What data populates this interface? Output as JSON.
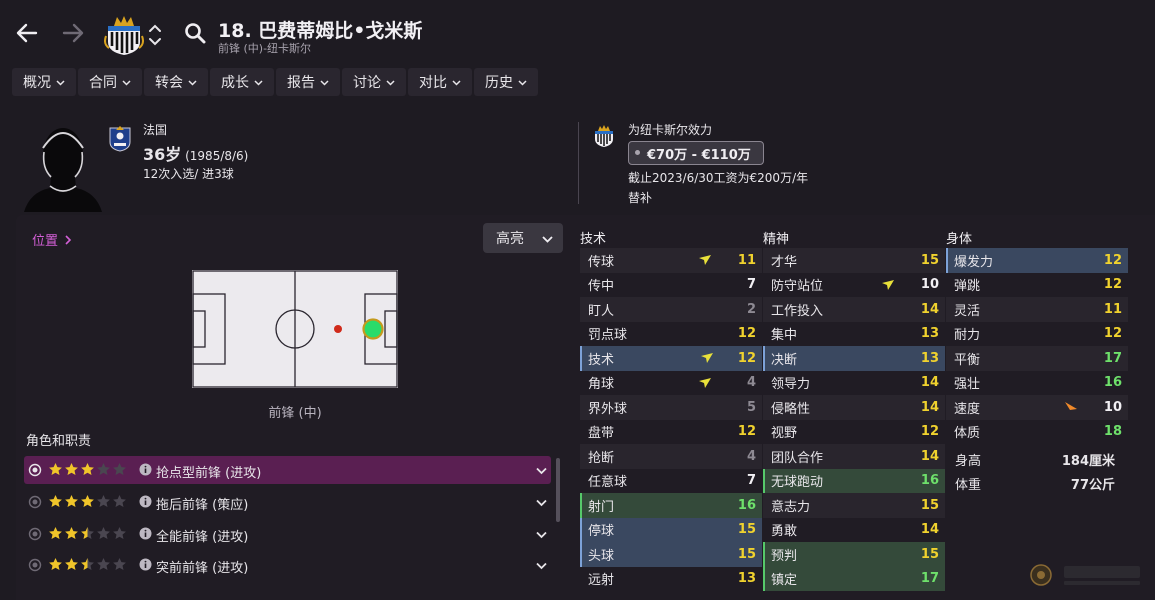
{
  "header": {
    "title": "18. 巴费蒂姆比•戈米斯",
    "subtitle": "前锋 (中)-纽卡斯尔"
  },
  "menu": [
    {
      "label": "概况"
    },
    {
      "label": "合同"
    },
    {
      "label": "转会"
    },
    {
      "label": "成长"
    },
    {
      "label": "报告"
    },
    {
      "label": "讨论"
    },
    {
      "label": "对比"
    },
    {
      "label": "历史"
    }
  ],
  "profile": {
    "nation": "法国",
    "age": "36岁",
    "birth": "(1985/8/6)",
    "caps": "12次入选/ 进3球",
    "plays_for": "为纽卡斯尔效力",
    "value": "€70万 - €110万",
    "contract": "截止2023/6/30工资为€200万/年",
    "status": "替补"
  },
  "position_panel": {
    "link_label": "位置",
    "highlight_label": "高亮",
    "pitch_label": "前锋 (中)",
    "roles_title": "角色和职责"
  },
  "roles": [
    {
      "name": "抢点型前锋 (进攻)",
      "stars": 3,
      "selected": true
    },
    {
      "name": "拖后前锋 (策应)",
      "stars": 3,
      "selected": false
    },
    {
      "name": "全能前锋 (进攻)",
      "stars": 2.5,
      "selected": false
    },
    {
      "name": "突前前锋 (进攻)",
      "stars": 2.5,
      "selected": false
    }
  ],
  "attributes": {
    "technical": {
      "title": "技术",
      "items": [
        {
          "name": "传球",
          "value": "11",
          "color": "yellow",
          "style": "alt",
          "arrow": "up"
        },
        {
          "name": "传中",
          "value": "7",
          "color": "white",
          "style": "",
          "arrow": ""
        },
        {
          "name": "盯人",
          "value": "2",
          "color": "gray",
          "style": "alt",
          "arrow": ""
        },
        {
          "name": "罚点球",
          "value": "12",
          "color": "yellow",
          "style": "",
          "arrow": ""
        },
        {
          "name": "技术",
          "value": "12",
          "color": "yellow",
          "style": "hl",
          "arrow": "up"
        },
        {
          "name": "角球",
          "value": "4",
          "color": "gray",
          "style": "",
          "arrow": "up"
        },
        {
          "name": "界外球",
          "value": "5",
          "color": "gray",
          "style": "alt",
          "arrow": ""
        },
        {
          "name": "盘带",
          "value": "12",
          "color": "yellow",
          "style": "",
          "arrow": ""
        },
        {
          "name": "抢断",
          "value": "4",
          "color": "gray",
          "style": "alt",
          "arrow": ""
        },
        {
          "name": "任意球",
          "value": "7",
          "color": "white",
          "style": "",
          "arrow": ""
        },
        {
          "name": "射门",
          "value": "16",
          "color": "green",
          "style": "green",
          "arrow": ""
        },
        {
          "name": "停球",
          "value": "15",
          "color": "yellow",
          "style": "hl",
          "arrow": ""
        },
        {
          "name": "头球",
          "value": "15",
          "color": "yellow",
          "style": "hl",
          "arrow": ""
        },
        {
          "name": "远射",
          "value": "13",
          "color": "yellow",
          "style": "",
          "arrow": ""
        }
      ]
    },
    "mental": {
      "title": "精神",
      "items": [
        {
          "name": "才华",
          "value": "15",
          "color": "yellow",
          "style": "alt",
          "arrow": ""
        },
        {
          "name": "防守站位",
          "value": "10",
          "color": "white",
          "style": "",
          "arrow": "up"
        },
        {
          "name": "工作投入",
          "value": "14",
          "color": "yellow",
          "style": "alt",
          "arrow": ""
        },
        {
          "name": "集中",
          "value": "13",
          "color": "yellow",
          "style": "",
          "arrow": ""
        },
        {
          "name": "决断",
          "value": "13",
          "color": "yellow",
          "style": "hl",
          "arrow": ""
        },
        {
          "name": "领导力",
          "value": "14",
          "color": "yellow",
          "style": "",
          "arrow": ""
        },
        {
          "name": "侵略性",
          "value": "14",
          "color": "yellow",
          "style": "alt",
          "arrow": ""
        },
        {
          "name": "视野",
          "value": "12",
          "color": "yellow",
          "style": "",
          "arrow": ""
        },
        {
          "name": "团队合作",
          "value": "14",
          "color": "yellow",
          "style": "alt",
          "arrow": ""
        },
        {
          "name": "无球跑动",
          "value": "16",
          "color": "green",
          "style": "green",
          "arrow": ""
        },
        {
          "name": "意志力",
          "value": "15",
          "color": "yellow",
          "style": "alt",
          "arrow": ""
        },
        {
          "name": "勇敢",
          "value": "14",
          "color": "yellow",
          "style": "",
          "arrow": ""
        },
        {
          "name": "预判",
          "value": "15",
          "color": "yellow",
          "style": "green",
          "arrow": ""
        },
        {
          "name": "镇定",
          "value": "17",
          "color": "green",
          "style": "green",
          "arrow": ""
        }
      ]
    },
    "physical": {
      "title": "身体",
      "items": [
        {
          "name": "爆发力",
          "value": "12",
          "color": "yellow",
          "style": "hl",
          "arrow": ""
        },
        {
          "name": "弹跳",
          "value": "12",
          "color": "yellow",
          "style": "",
          "arrow": ""
        },
        {
          "name": "灵活",
          "value": "11",
          "color": "yellow",
          "style": "alt",
          "arrow": ""
        },
        {
          "name": "耐力",
          "value": "12",
          "color": "yellow",
          "style": "",
          "arrow": ""
        },
        {
          "name": "平衡",
          "value": "17",
          "color": "green",
          "style": "alt",
          "arrow": ""
        },
        {
          "name": "强壮",
          "value": "16",
          "color": "green",
          "style": "",
          "arrow": ""
        },
        {
          "name": "速度",
          "value": "10",
          "color": "white",
          "style": "alt",
          "arrow": "down"
        },
        {
          "name": "体质",
          "value": "18",
          "color": "green",
          "style": "",
          "arrow": ""
        }
      ],
      "height_label": "身高",
      "height_value": "184厘米",
      "weight_label": "体重",
      "weight_value": "77公斤"
    }
  },
  "colors": {
    "accent": "#d35fd6",
    "selected_role": "#5a1f52",
    "highlight_row": "#3a4860",
    "green_row": "#344a3a",
    "value_yellow": "#f0d22e",
    "value_green": "#6ee06b"
  },
  "icons": {
    "back": "back-arrow-icon",
    "forward": "forward-arrow-icon",
    "search": "search-icon",
    "info": "info-icon"
  }
}
